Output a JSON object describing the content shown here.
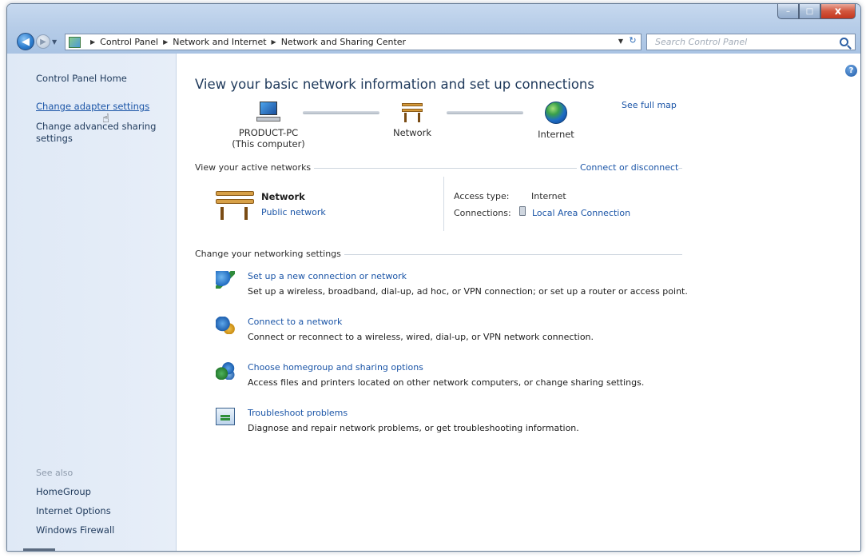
{
  "window": {
    "caption_minimize": "–",
    "caption_maximize": "□",
    "caption_close": "x"
  },
  "nav": {
    "back_glyph": "◀",
    "forward_glyph": "▶",
    "recent_glyph": "▼",
    "breadcrumb": [
      "Control Panel",
      "Network and Internet",
      "Network and Sharing Center"
    ],
    "separator": "▶",
    "dropdown_glyph": "▼",
    "refresh_glyph": "↻",
    "search_placeholder": "Search Control Panel"
  },
  "sidebar": {
    "home": "Control Panel Home",
    "links": [
      "Change adapter settings",
      "Change advanced sharing settings"
    ],
    "cursor_glyph": "☝",
    "see_also_title": "See also",
    "see_also": [
      "HomeGroup",
      "Internet Options",
      "Windows Firewall"
    ]
  },
  "main": {
    "help_glyph": "?",
    "title": "View your basic network information and set up connections",
    "see_full_map": "See full map",
    "map": {
      "computer_name": "PRODUCT-PC",
      "computer_sub": "(This computer)",
      "network": "Network",
      "internet": "Internet"
    },
    "active_networks": {
      "heading": "View your active networks",
      "connect_link": "Connect or disconnect",
      "network_name": "Network",
      "network_type": "Public network",
      "access_type_label": "Access type:",
      "access_type_value": "Internet",
      "connections_label": "Connections:",
      "connections_value": "Local Area Connection"
    },
    "settings": {
      "heading": "Change your networking settings",
      "tasks": [
        {
          "link": "Set up a new connection or network",
          "desc": "Set up a wireless, broadband, dial-up, ad hoc, or VPN connection; or set up a router or access point.",
          "icon": "network-setup-icon"
        },
        {
          "link": "Connect to a network",
          "desc": "Connect or reconnect to a wireless, wired, dial-up, or VPN network connection.",
          "icon": "connect-network-icon"
        },
        {
          "link": "Choose homegroup and sharing options",
          "desc": "Access files and printers located on other network computers, or change sharing settings.",
          "icon": "homegroup-icon"
        },
        {
          "link": "Troubleshoot problems",
          "desc": "Diagnose and repair network problems, or get troubleshooting information.",
          "icon": "troubleshoot-icon"
        }
      ]
    }
  },
  "colors": {
    "link": "#1b55a7",
    "heading": "#1e395b",
    "sidebar_bg": "#dfe9f6",
    "titlebar": "#b7cde8",
    "close_button": "#c3371f"
  }
}
